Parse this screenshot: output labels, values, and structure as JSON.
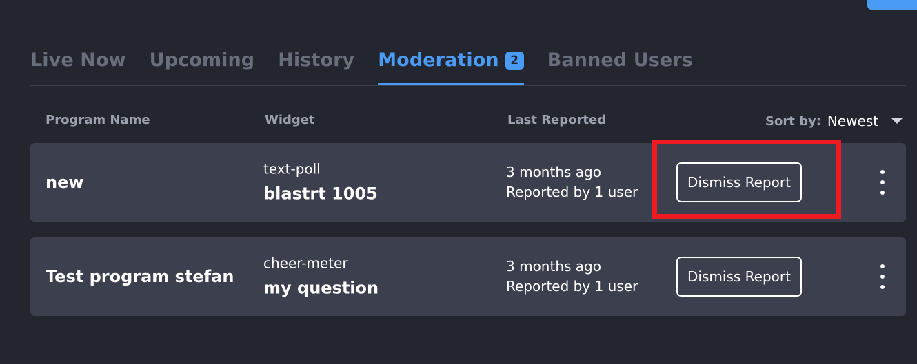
{
  "top_right_action": {
    "name": "primary-action-button"
  },
  "tabs": [
    {
      "label": "Live Now",
      "active": false,
      "badge": null
    },
    {
      "label": "Upcoming",
      "active": false,
      "badge": null
    },
    {
      "label": "History",
      "active": false,
      "badge": null
    },
    {
      "label": "Moderation",
      "active": true,
      "badge": "2"
    },
    {
      "label": "Banned Users",
      "active": false,
      "badge": null
    }
  ],
  "columns": {
    "program_name": "Program Name",
    "widget": "Widget",
    "last_reported": "Last Reported"
  },
  "sort": {
    "label": "Sort by:",
    "value": "Newest",
    "options": [
      "Newest"
    ]
  },
  "rows": [
    {
      "program_name": "new",
      "widget_type": "text-poll",
      "widget_name": "blastrt 1005",
      "reported_when": "3 months ago",
      "reported_by": "Reported by 1 user",
      "dismiss_label": "Dismiss Report"
    },
    {
      "program_name": "Test program stefan",
      "widget_type": "cheer-meter",
      "widget_name": "my question",
      "reported_when": "3 months ago",
      "reported_by": "Reported by 1 user",
      "dismiss_label": "Dismiss Report"
    }
  ],
  "colors": {
    "page_background": "#24262f",
    "row_background": "#3c3f4e",
    "accent": "#4a9bf5",
    "inactive_tab": "#696e7c",
    "annotation": "#ee1c22"
  }
}
